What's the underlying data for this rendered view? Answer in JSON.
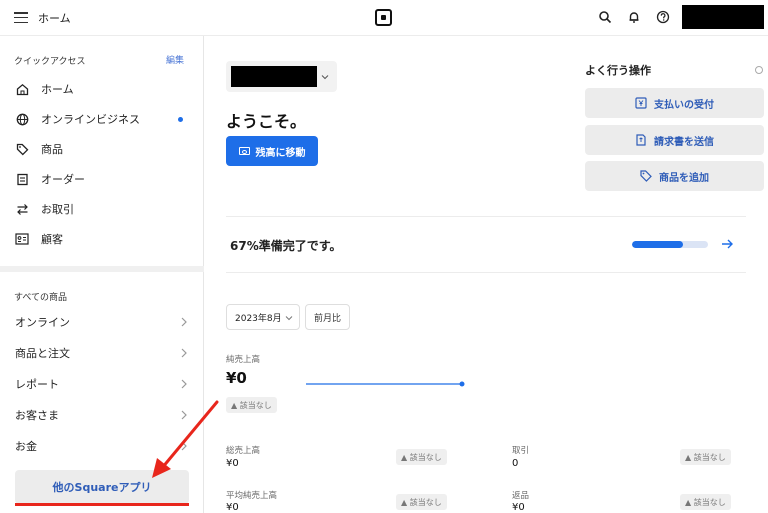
{
  "topbar": {
    "home_label": "ホーム"
  },
  "sidebar": {
    "quick_access_title": "クイックアクセス",
    "edit_label": "編集",
    "quick_items": [
      {
        "label": "ホーム",
        "icon": "home-icon"
      },
      {
        "label": "オンラインビジネス",
        "icon": "globe-icon",
        "dot": true
      },
      {
        "label": "商品",
        "icon": "tag-icon"
      },
      {
        "label": "オーダー",
        "icon": "order-icon"
      },
      {
        "label": "お取引",
        "icon": "transfer-icon"
      },
      {
        "label": "顧客",
        "icon": "customer-card-icon"
      }
    ],
    "all_products_title": "すべての商品",
    "categories": [
      {
        "label": "オンライン"
      },
      {
        "label": "商品と注文"
      },
      {
        "label": "レポート"
      },
      {
        "label": "お客さま"
      },
      {
        "label": "お金"
      }
    ],
    "other_apps_label": "他のSquareアプリ"
  },
  "main": {
    "welcome": "ようこそ。",
    "balance_button": "残高に移動",
    "frequent_title": "よく行う操作",
    "frequent_actions": [
      {
        "label": "支払いの受付",
        "icon": "yen-icon"
      },
      {
        "label": "請求書を送信",
        "icon": "invoice-icon"
      },
      {
        "label": "商品を追加",
        "icon": "tag-icon"
      }
    ],
    "progress": {
      "text": "67%準備完了です。",
      "percent": 67
    },
    "date_select": "2023年8月",
    "compare_label": "前月比",
    "net_sales": {
      "label": "純売上高",
      "value": "¥0",
      "badge": "▲ 該当なし"
    },
    "stats": [
      {
        "label": "総売上高",
        "value": "¥0",
        "badge": "▲ 該当なし"
      },
      {
        "label": "取引",
        "value": "0",
        "badge": "▲ 該当なし"
      },
      {
        "label": "平均純売上高",
        "value": "¥0",
        "badge": "▲ 該当なし"
      },
      {
        "label": "返品",
        "value": "¥0",
        "badge": "▲ 該当なし"
      }
    ]
  },
  "colors": {
    "accent": "#1e6ee8",
    "link": "#2f5db8",
    "annotation": "#e8261c"
  }
}
